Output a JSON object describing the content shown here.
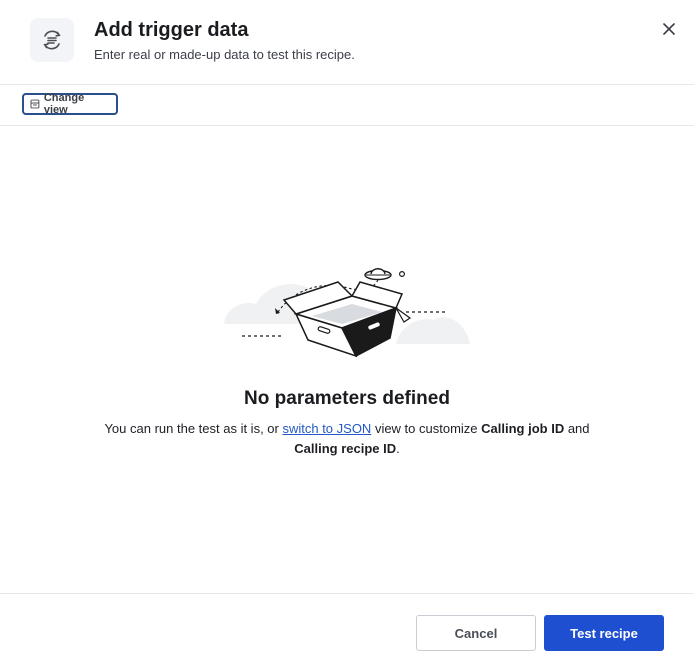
{
  "header": {
    "title": "Add trigger data",
    "subtitle": "Enter real or made-up data to test this recipe.",
    "icon": "trigger-data-icon",
    "close_icon": "close-icon"
  },
  "toolbar": {
    "change_view_label": "Change view",
    "change_view_icon": "view-icon"
  },
  "empty_state": {
    "illustration": "empty-box-ufo-illustration",
    "title": "No parameters defined",
    "text_before_link": "You can run the test as it is, or ",
    "link_label": "switch to JSON",
    "text_after_link": " view to customize ",
    "field_1": "Calling job ID",
    "text_between_fields": " and ",
    "field_2": "Calling recipe ID",
    "text_end": "."
  },
  "footer": {
    "cancel_label": "Cancel",
    "primary_label": "Test recipe"
  },
  "colors": {
    "primary": "#1f4fd1",
    "link": "#2259c4",
    "focus_border": "#2a4f8c"
  }
}
